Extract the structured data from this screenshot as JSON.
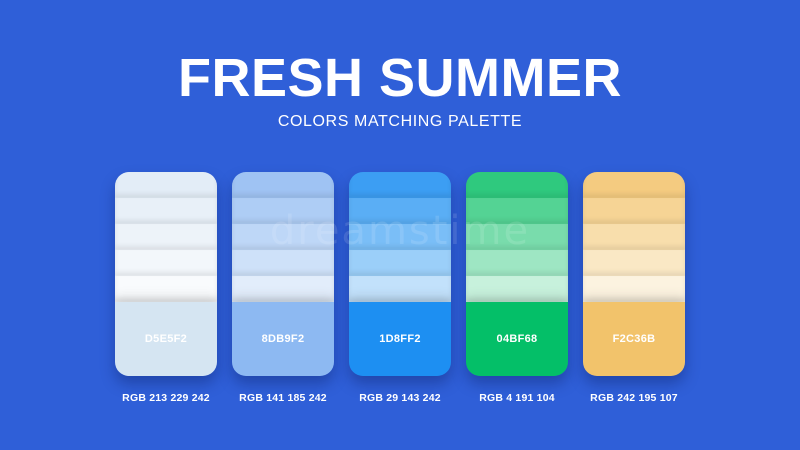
{
  "header": {
    "title": "FRESH SUMMER",
    "subtitle": "COLORS MATCHING PALETTE"
  },
  "watermark": "dreamstime",
  "palette": [
    {
      "hex_label": "D5E5F2",
      "rgb_label": "RGB 213 229 242",
      "base_color": "#D5E5F2",
      "tints": [
        "#E3EDF7",
        "#E8F0F8",
        "#EDF3F9",
        "#F3F7FB",
        "#F9FBFD"
      ]
    },
    {
      "hex_label": "8DB9F2",
      "rgb_label": "RGB 141 185 242",
      "base_color": "#8DB9F2",
      "tints": [
        "#9FC3F3",
        "#AECDF5",
        "#BED7F7",
        "#CEE1F9",
        "#E2EDFB"
      ]
    },
    {
      "hex_label": "1D8FF2",
      "rgb_label": "RGB 29 143 242",
      "base_color": "#1D8FF2",
      "tints": [
        "#3C9EF3",
        "#5AAEF5",
        "#7ABEF7",
        "#9BCFF9",
        "#C2E1FB"
      ]
    },
    {
      "hex_label": "04BF68",
      "rgb_label": "RGB 4 191 104",
      "base_color": "#04BF68",
      "tints": [
        "#2FC97E",
        "#54D394",
        "#79DCAC",
        "#9EE6C3",
        "#C7F1DC"
      ]
    },
    {
      "hex_label": "F2C36B",
      "rgb_label": "RGB 242 195 107",
      "base_color": "#F2C36B",
      "tints": [
        "#F4CB80",
        "#F6D495",
        "#F8DEAC",
        "#FAE8C5",
        "#FCF3E0"
      ]
    }
  ]
}
